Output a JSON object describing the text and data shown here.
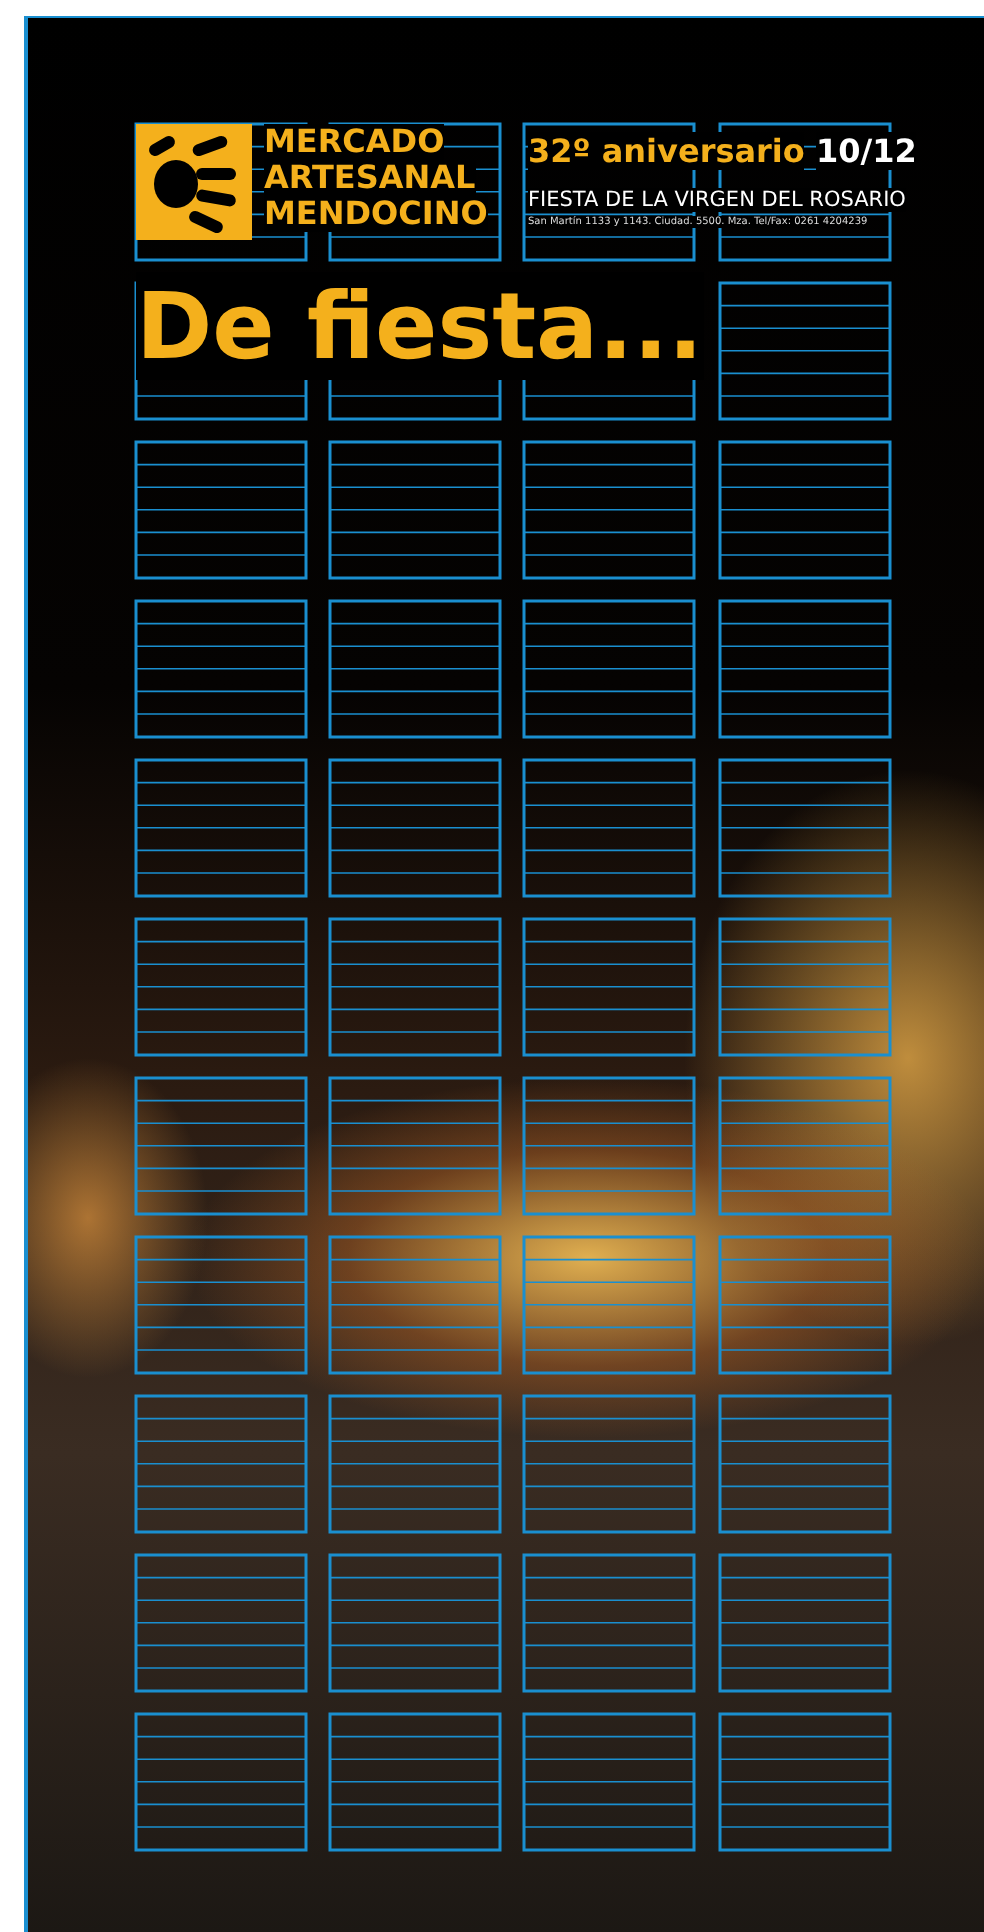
{
  "logo": {
    "lines": [
      "MERCADO",
      "ARTESANAL",
      "MENDOCINO"
    ]
  },
  "anniversary": "32º aniversario",
  "date": "10/12",
  "event": "FIESTA DE LA VIRGEN DEL ROSARIO",
  "address": "San Martín 1133 y 1143. Ciudad. 5500. Mza. Tel/Fax: 0261 4204239",
  "headline": "De fiesta..."
}
